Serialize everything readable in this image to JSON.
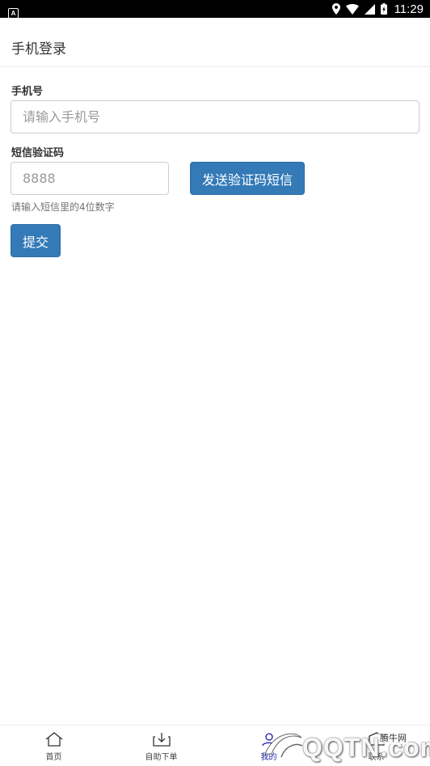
{
  "status_bar": {
    "app_badge": "A",
    "time": "11:29"
  },
  "header": {
    "title": "手机登录"
  },
  "form": {
    "phone_label": "手机号",
    "phone_placeholder": "请输入手机号",
    "sms_label": "短信验证码",
    "sms_placeholder": "8888",
    "send_code_button": "发送验证码短信",
    "help_text": "请输入短信里的4位数字",
    "submit_button": "提交"
  },
  "bottom_nav": {
    "items": [
      {
        "label": "首页",
        "icon": "home-icon"
      },
      {
        "label": "自助下单",
        "icon": "download-icon"
      },
      {
        "label": "我的",
        "icon": "user-icon"
      },
      {
        "label": "联系",
        "icon": "contact-icon"
      }
    ]
  },
  "watermark": {
    "text": "QQTN.com",
    "sub": "腾牛网"
  }
}
